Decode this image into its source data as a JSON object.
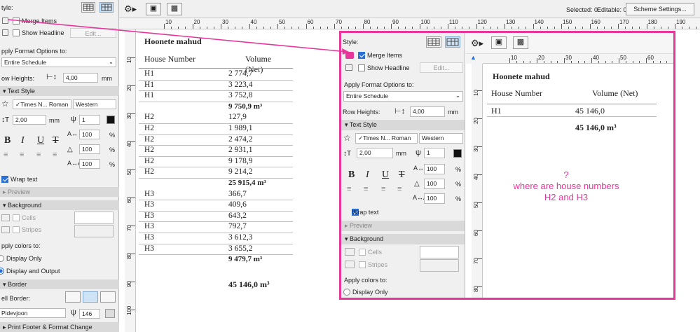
{
  "left_panel": {
    "style_label": "tyle:",
    "merge_items": "Merge Items",
    "show_headline": "Show Headline",
    "edit_button": "Edit...",
    "apply_format_label": "pply Format Options to:",
    "apply_format_value": "Entire Schedule",
    "row_heights_label": "ow Heights:",
    "row_heights_value": "4,00",
    "unit_mm": "mm",
    "text_style": "Text Style",
    "font_name": "✓Times N... Roman",
    "script": "Western",
    "size_value": "2,00",
    "num_1": "1",
    "pct_100": "100",
    "pct": "%",
    "bold": "B",
    "italic": "I",
    "underline": "U",
    "strike": "T",
    "wrap_text": "Wrap text",
    "preview": "Preview",
    "background": "Background",
    "cells": "Cells",
    "stripes": "Stripes",
    "apply_colors": "pply colors to:",
    "display_only": "Display Only",
    "display_output": "Display and Output",
    "border": "Border",
    "cell_border": "ell Border:",
    "line_type": "Pidevjoon",
    "pen_value": "146",
    "footer": "Print Footer & Format Change"
  },
  "toolbar": {
    "selected": "Selected: 0",
    "editable": "Editable: 0",
    "scheme_settings": "Scheme Settings..."
  },
  "ruler_top_labels": [
    "10",
    "20",
    "30",
    "40",
    "50",
    "60",
    "70",
    "80",
    "90",
    "100",
    "110",
    "120",
    "130",
    "140",
    "150",
    "160",
    "170",
    "180",
    "190"
  ],
  "ruler_left_labels": [
    "10",
    "20",
    "30",
    "40",
    "50",
    "60",
    "70",
    "80",
    "90",
    "100"
  ],
  "schedule": {
    "title": "Hoonete mahud",
    "col1": "House Number",
    "col2": "Volume (Net)",
    "rows": [
      {
        "h": "H1",
        "v": "2 774,7"
      },
      {
        "h": "H1",
        "v": "3 223,4"
      },
      {
        "h": "H1",
        "v": "3 752,8"
      },
      {
        "h": "",
        "v": "9  750,9 m³",
        "sub": true
      },
      {
        "h": "H2",
        "v": "127,9"
      },
      {
        "h": "H2",
        "v": "1 989,1"
      },
      {
        "h": "H2",
        "v": "2 474,2"
      },
      {
        "h": "H2",
        "v": "2 931,1"
      },
      {
        "h": "H2",
        "v": "9 178,9"
      },
      {
        "h": "H2",
        "v": "9 214,2"
      },
      {
        "h": "",
        "v": "25  915,4 m³",
        "sub": true
      },
      {
        "h": "H3",
        "v": "366,7"
      },
      {
        "h": "H3",
        "v": "409,6"
      },
      {
        "h": "H3",
        "v": "643,2"
      },
      {
        "h": "H3",
        "v": "792,7"
      },
      {
        "h": "H3",
        "v": "3 612,3"
      },
      {
        "h": "H3",
        "v": "3 655,2"
      },
      {
        "h": "",
        "v": "9  479,7 m³",
        "sub": true
      }
    ],
    "total": "45 146,0 m³"
  },
  "right_panel": {
    "style_label": "Style:",
    "merge_items": "Merge Items",
    "show_headline": "Show Headline",
    "edit_button": "Edit...",
    "apply_format_label": "Apply Format Options to:",
    "apply_format_value": "Entire Schedule",
    "row_heights_label": "Row Heights:",
    "row_heights_value": "4,00",
    "unit_mm": "mm",
    "text_style": "Text Style",
    "font_name": "✓Times N... Roman",
    "script": "Western",
    "size_value": "2,00",
    "num_1": "1",
    "pct_100": "100",
    "pct": "%",
    "bold": "B",
    "italic": "I",
    "underline": "U",
    "strike": "T",
    "wrap_text": "Wrap text",
    "preview": "Preview",
    "background": "Background",
    "cells": "Cells",
    "stripes": "Stripes",
    "apply_colors": "Apply colors to:",
    "display_only": "Display Only"
  },
  "right_ruler_top_labels": [
    "10",
    "20",
    "30",
    "40",
    "50",
    "60"
  ],
  "right_ruler_left_labels": [
    "10",
    "20",
    "30",
    "40",
    "50",
    "60",
    "70",
    "80"
  ],
  "right_schedule": {
    "title": "Hoonete mahud",
    "col1": "House Number",
    "col2": "Volume (Net)",
    "row_h": "H1",
    "row_v": "45 146,0",
    "total": "45 146,0 m³"
  },
  "annotation": {
    "q": "?",
    "line1": "where are house numbers",
    "line2": "H2 and H3"
  },
  "colors": {
    "highlight": "#e8359a",
    "accent": "#2a6fd6"
  }
}
